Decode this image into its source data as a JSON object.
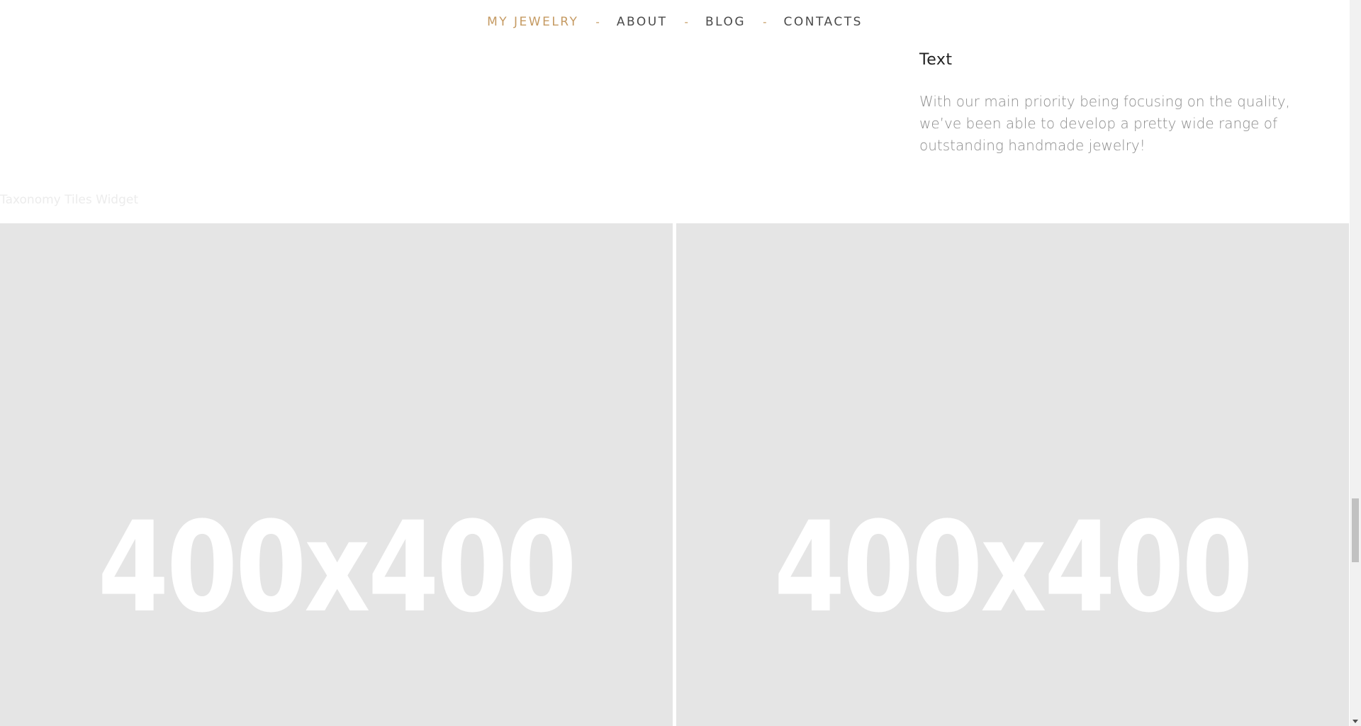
{
  "nav": {
    "items": [
      {
        "label": "MY JEWELRY",
        "active": true
      },
      {
        "label": "ABOUT",
        "active": false
      },
      {
        "label": "BLOG",
        "active": false
      },
      {
        "label": "CONTACTS",
        "active": false
      }
    ],
    "separator": "-",
    "active_color": "#c59a62"
  },
  "text_widget": {
    "title": "Text",
    "body": "With our main priority being focusing on the quality, we’ve been able to develop a pretty wide range of outstanding handmade jewelry!"
  },
  "taxonomy_widget": {
    "label": "Taxonomy Tiles Widget",
    "tiles": [
      {
        "placeholder": "400x400"
      },
      {
        "placeholder": "400x400"
      }
    ]
  }
}
